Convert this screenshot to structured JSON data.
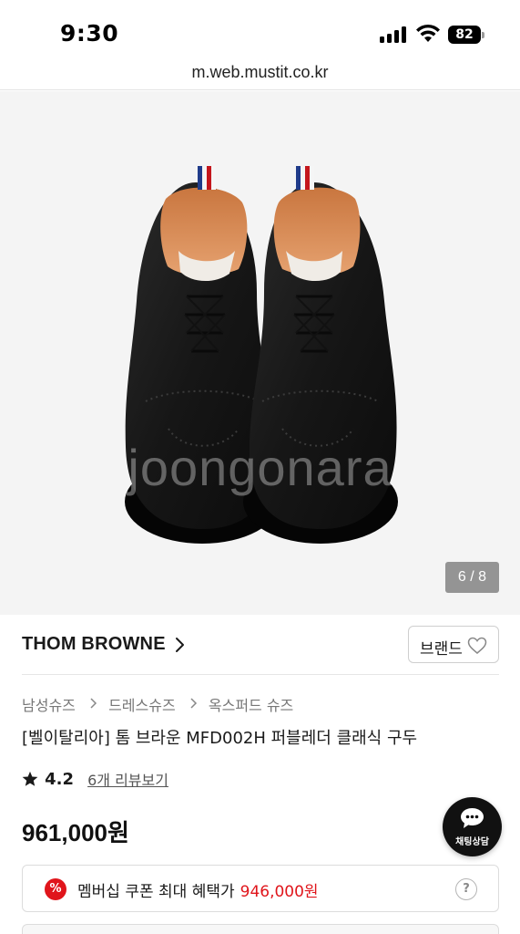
{
  "status_bar": {
    "time": "9:30",
    "battery": "82",
    "icons": [
      "signal-icon",
      "wifi-icon",
      "battery-icon"
    ]
  },
  "browser": {
    "url": "m.web.mustit.co.kr"
  },
  "gallery": {
    "watermark": "joongonara",
    "counter": "6 / 8",
    "current": 6,
    "total": 8
  },
  "brand": {
    "name": "THOM BROWNE",
    "button_label": "브랜드",
    "icons": [
      "chevron-right-icon",
      "heart-icon"
    ]
  },
  "breadcrumb": [
    "남성슈즈",
    "드레스슈즈",
    "옥스퍼드 슈즈"
  ],
  "product": {
    "title": "[벨이탈리아] 톰 브라운 MFD002H 퍼블레더 클래식 구두",
    "rating": "4.2",
    "reviews_label": "6개 리뷰보기",
    "price": "961,000원"
  },
  "chat": {
    "label": "채팅상담",
    "icon": "chat-bubble-icon"
  },
  "coupon": {
    "icon_symbol": "%",
    "label": "멤버십 쿠폰 최대 혜택가",
    "amount": "946,000원",
    "help_symbol": "?"
  },
  "colors": {
    "accent_red": "#e0151b",
    "text": "#1a1a1a",
    "muted": "#777777",
    "chat_button": "#111111"
  }
}
